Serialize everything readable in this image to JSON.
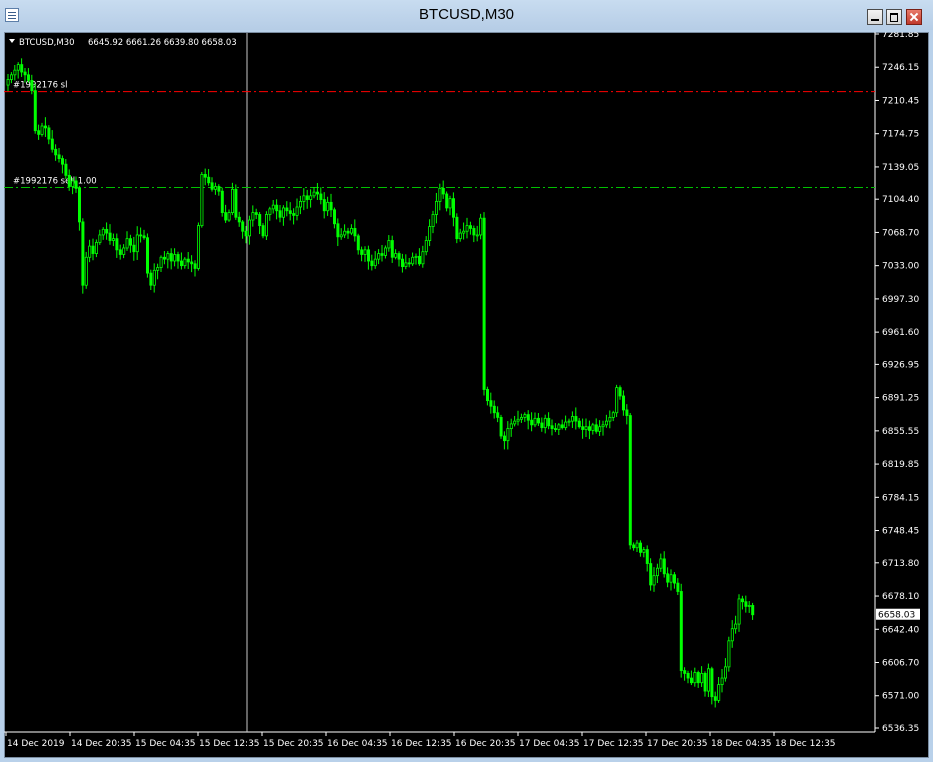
{
  "window": {
    "title": "BTCUSD,M30",
    "buttons": {
      "minimize": "minimize-icon",
      "maximize": "maximize-icon",
      "close": "close-icon"
    }
  },
  "chart_header": {
    "symbol": "BTCUSD,M30",
    "ohlc": "6645.92 6661.26 6639.80 6658.03"
  },
  "orders": {
    "sl_label": "#1992176 sl",
    "sell_label": "#1992176 sell 1.00"
  },
  "current_price": "6658.03",
  "colors": {
    "background": "#000000",
    "candles": "#00ff00",
    "sl_line": "#ff0000",
    "order_line": "#00c000",
    "text": "#ffffff",
    "crosshair": "#c8c8c8"
  },
  "chart_data": {
    "type": "candlestick",
    "ylim": [
      6526,
      7290
    ],
    "y_ticks": [
      "7281.85",
      "7246.15",
      "7210.45",
      "7174.75",
      "7139.05",
      "7104.40",
      "7068.70",
      "7033.00",
      "6997.30",
      "6961.60",
      "6926.95",
      "6891.25",
      "6855.55",
      "6819.85",
      "6784.15",
      "6748.45",
      "6713.80",
      "6678.10",
      "6642.40",
      "6606.70",
      "6571.00",
      "6536.35"
    ],
    "x_ticks": [
      "14 Dec 2019",
      "14 Dec 20:35",
      "15 Dec 04:35",
      "15 Dec 12:35",
      "15 Dec 20:35",
      "16 Dec 04:35",
      "16 Dec 12:35",
      "16 Dec 20:35",
      "17 Dec 04:35",
      "17 Dec 12:35",
      "17 Dec 20:35",
      "18 Dec 04:35",
      "18 Dec 12:35"
    ],
    "sl_price": 7220,
    "entry_price": 7117,
    "close_series": [
      7233,
      7238,
      7243,
      7249,
      7241,
      7238,
      7232,
      7221,
      7178,
      7174,
      7183,
      7181,
      7169,
      7158,
      7152,
      7148,
      7142,
      7130,
      7118,
      7124,
      7116,
      7080,
      7012,
      7042,
      7054,
      7046,
      7058,
      7066,
      7072,
      7068,
      7060,
      7062,
      7050,
      7045,
      7052,
      7062,
      7055,
      7048,
      7066,
      7065,
      7063,
      7025,
      7012,
      7028,
      7031,
      7042,
      7040,
      7046,
      7038,
      7045,
      7038,
      7033,
      7040,
      7037,
      7035,
      7030,
      7076,
      7131,
      7128,
      7122,
      7115,
      7118,
      7113,
      7090,
      7082,
      7090,
      7115,
      7085,
      7080,
      7070,
      7065,
      7082,
      7090,
      7088,
      7076,
      7065,
      7088,
      7094,
      7098,
      7092,
      7085,
      7095,
      7092,
      7089,
      7087,
      7096,
      7102,
      7108,
      7104,
      7108,
      7112,
      7110,
      7104,
      7092,
      7101,
      7093,
      7078,
      7064,
      7066,
      7070,
      7068,
      7073,
      7065,
      7050,
      7045,
      7050,
      7038,
      7033,
      7040,
      7046,
      7044,
      7052,
      7060,
      7042,
      7046,
      7040,
      7032,
      7036,
      7035,
      7042,
      7043,
      7035,
      7048,
      7060,
      7075,
      7088,
      7102,
      7116,
      7110,
      7095,
      7105,
      7085,
      7062,
      7068,
      7070,
      7076,
      7073,
      7066,
      7066,
      7084,
      6900,
      6888,
      6882,
      6875,
      6870,
      6850,
      6845,
      6858,
      6863,
      6866,
      6868,
      6870,
      6873,
      6867,
      6862,
      6869,
      6864,
      6859,
      6869,
      6861,
      6858,
      6857,
      6862,
      6859,
      6865,
      6866,
      6871,
      6866,
      6860,
      6857,
      6860,
      6856,
      6862,
      6855,
      6860,
      6862,
      6866,
      6870,
      6875,
      6902,
      6893,
      6878,
      6872,
      6733,
      6730,
      6735,
      6725,
      6728,
      6713,
      6690,
      6700,
      6708,
      6718,
      6702,
      6693,
      6701,
      6692,
      6683,
      6598,
      6595,
      6590,
      6585,
      6596,
      6585,
      6595,
      6576,
      6600,
      6570,
      6566,
      6583,
      6590,
      6602,
      6630,
      6643,
      6648,
      6675,
      6672,
      6667,
      6668,
      6658
    ]
  }
}
